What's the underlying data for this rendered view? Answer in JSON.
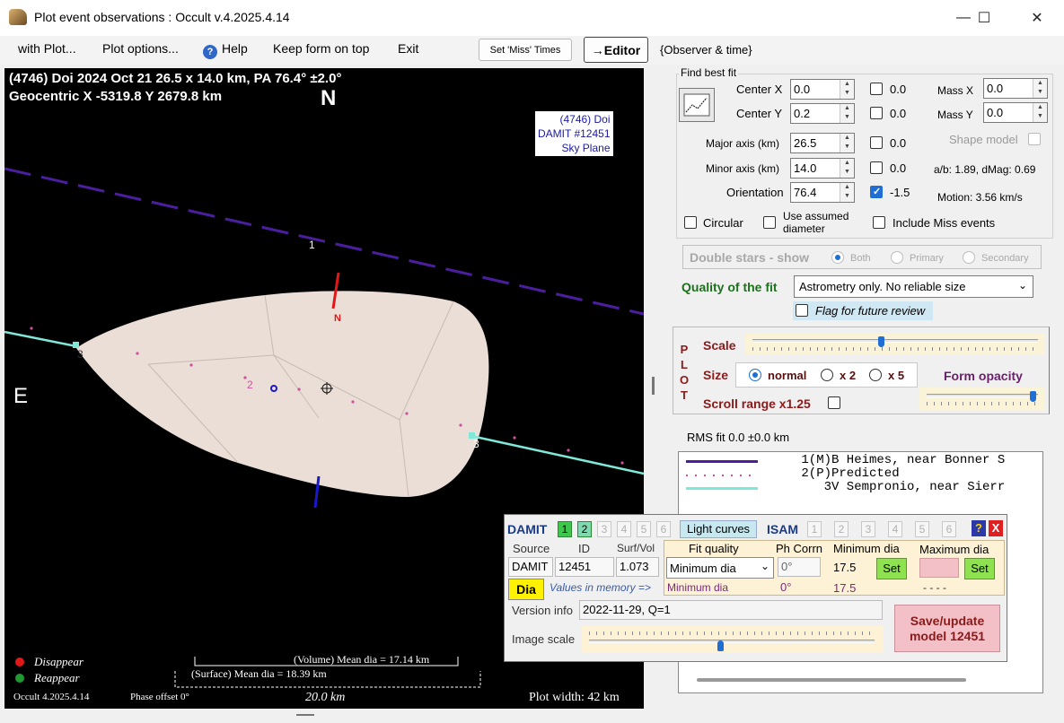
{
  "window": {
    "title": "Plot event observations : Occult v.4.2025.4.14",
    "minimize_glyph": "—",
    "maximize_glyph": "☐",
    "close_glyph": "✕"
  },
  "menu": {
    "with_plot": "with Plot...",
    "plot_options": "Plot options...",
    "help": "Help",
    "keep_on_top": "Keep form on top",
    "exit": "Exit",
    "set_miss_times": "Set 'Miss' Times",
    "editor": "→Editor",
    "observer_time": "{Observer & time}"
  },
  "plot": {
    "header_line1": "(4746) Doi  2024 Oct 21   26.5 x 14.0 km, PA 76.4° ±2.0°",
    "header_line2": "Geocentric  X  -5319.8  Y 2679.8 km",
    "north": "N",
    "east": "E",
    "n_marker": "N",
    "legend": [
      "(4746) Doi",
      "DAMIT #12451",
      "Sky Plane"
    ],
    "chord_labels": [
      "1",
      "2",
      "3",
      "3"
    ],
    "disappear": "Disappear",
    "reappear": "Reappear",
    "volume_mean": "(Volume) Mean dia = 17.14 km",
    "surface_mean": "(Surface) Mean dia = 18.39 km",
    "version": "Occult 4.2025.4.14",
    "phase_offset": "Phase offset 0°",
    "scale_bar": "20.0 km",
    "plot_width": "Plot width: 42 km",
    "colors": {
      "chord1": "#4b1ea0",
      "chord3": "#7fe8d8",
      "predicted": "#d050a0",
      "shape": "#eaded6",
      "disappear": "#e01818",
      "reappear": "#1e9a30"
    }
  },
  "fit": {
    "group_title": "Find best fit",
    "center_x_label": "Center X",
    "center_x": "0.0",
    "center_x_cb": "0.0",
    "center_y_label": "Center Y",
    "center_y": "0.2",
    "center_y_cb": "0.0",
    "mass_x_label": "Mass X",
    "mass_x": "0.0",
    "mass_y_label": "Mass Y",
    "mass_y": "0.0",
    "major_label": "Major axis (km)",
    "major": "26.5",
    "major_cb": "0.0",
    "minor_label": "Minor axis (km)",
    "minor": "14.0",
    "minor_cb": "0.0",
    "orient_label": "Orientation",
    "orient": "76.4",
    "orient_cb": "-1.5",
    "shape_model": "Shape model",
    "ab_dmag": "a/b: 1.89, dMag: 0.69",
    "motion": "Motion: 3.56 km/s",
    "circular": "Circular",
    "assumed_dia": "Use assumed diameter",
    "include_miss": "Include Miss events"
  },
  "double_stars": {
    "label": "Double stars - show",
    "both": "Both",
    "primary": "Primary",
    "secondary": "Secondary"
  },
  "quality": {
    "label": "Quality of the fit",
    "value": "Astrometry only. No reliable size",
    "flag": "Flag for future review"
  },
  "plot_ctrl": {
    "plot_vertical": [
      "P",
      "L",
      "O",
      "T"
    ],
    "scale": "Scale",
    "size": "Size",
    "normal": "normal",
    "x2": "x 2",
    "x5": "x 5",
    "form_opacity": "Form opacity",
    "scroll_range": "Scroll range x1.25",
    "scale_level": 0.45,
    "opacity_level": 0.95
  },
  "rms": "RMS fit 0.0 ±0.0 km",
  "observers": [
    {
      "num": "1(M)",
      "name": "B Heimes, near Bonner S",
      "color": "#4b1ea0",
      "style": "solid"
    },
    {
      "num": "2(P)",
      "name": "Predicted",
      "color": "#d050a0",
      "style": "dots"
    },
    {
      "num": "3",
      "name": "V Sempronio, near Sierr",
      "color": "#7fe8d8",
      "style": "solid"
    }
  ],
  "damit": {
    "title": "DAMIT",
    "nums": [
      "1",
      "2",
      "3",
      "4",
      "5",
      "6"
    ],
    "light_curves": "Light curves",
    "isam": "ISAM",
    "isam_nums": [
      "1",
      "2",
      "3",
      "4",
      "5",
      "6"
    ],
    "help": "?",
    "close": "X",
    "source_label": "Source",
    "id_label": "ID",
    "surf_vol_label": "Surf/Vol",
    "source": "DAMIT",
    "id": "12451",
    "surf_vol": "1.073",
    "fit_quality_label": "Fit quality",
    "ph_corrn_label": "Ph Corrn",
    "min_dia_label": "Minimum dia",
    "max_dia_label": "Maximum dia",
    "fit_quality": "Minimum dia",
    "ph_corrn": "0°",
    "min_dia": "17.5",
    "set": "Set",
    "mem_fit": "Minimum dia",
    "mem_ph": "0°",
    "mem_min": "17.5",
    "mem_max": "- - - -",
    "dia": "Dia",
    "values_in_memory": "Values in memory =>",
    "version_label": "Version info",
    "version": "2022-11-29, Q=1",
    "image_scale_label": "Image scale",
    "image_scale_level": 0.46,
    "save": "Save/update model 12451"
  }
}
